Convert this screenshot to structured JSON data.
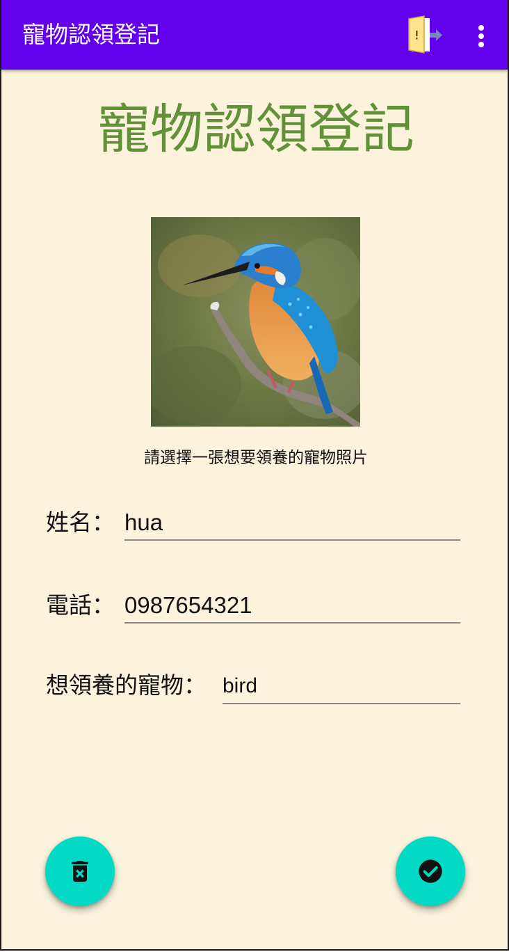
{
  "app_bar": {
    "title": "寵物認領登記",
    "exit_icon": "exit-door-icon",
    "overflow_icon": "more-vert-icon",
    "color": "#6200EE"
  },
  "main": {
    "heading": "寵物認領登記",
    "heading_color": "#62913A",
    "photo_hint": "請選擇一張想要領養的寵物照片",
    "background_color": "#FBF3DC"
  },
  "form": {
    "name": {
      "label": "姓名：",
      "value": "hua"
    },
    "phone": {
      "label": "電話：",
      "value": "0987654321"
    },
    "pet": {
      "label": "想領養的寵物：",
      "value": "bird"
    }
  },
  "actions": {
    "clear_icon": "delete-forever-icon",
    "submit_icon": "check-circle-icon",
    "fab_color": "#03DAC5"
  }
}
